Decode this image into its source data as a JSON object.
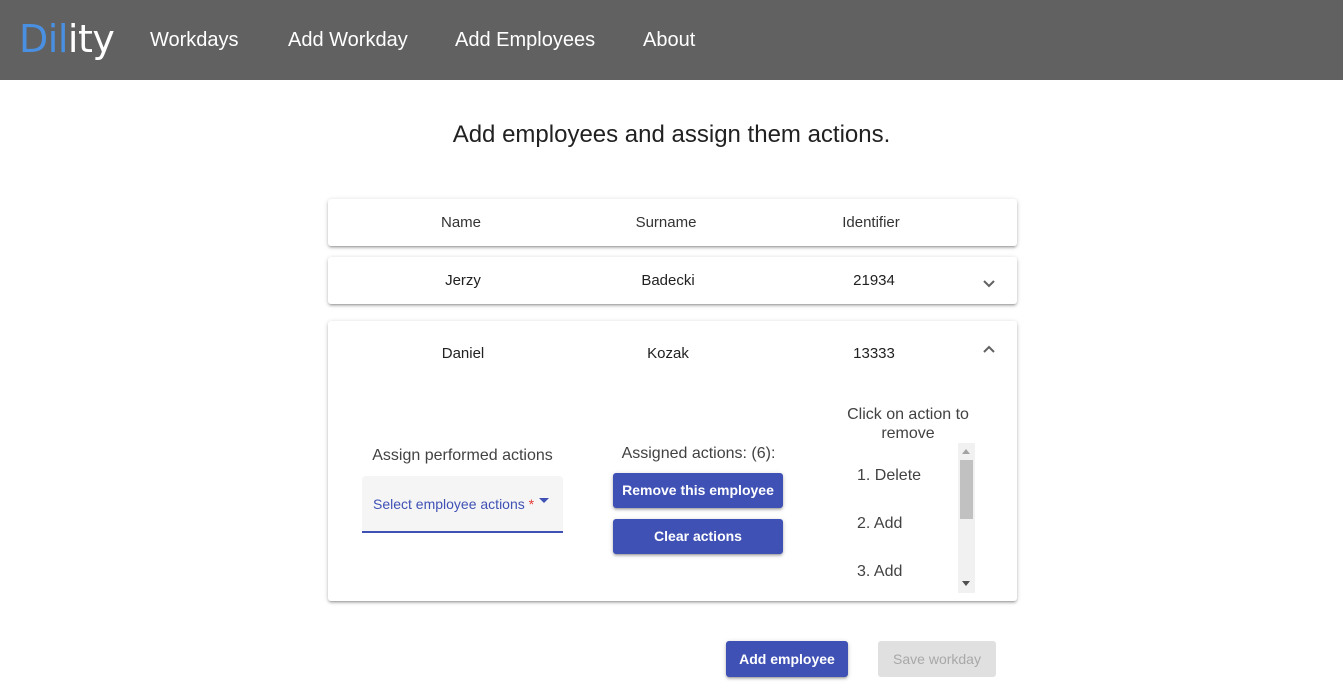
{
  "app": {
    "logo_part1": "Dil",
    "logo_part2": "ity",
    "nav": [
      "Workdays",
      "Add Workday",
      "Add Employees",
      "About"
    ]
  },
  "page": {
    "heading": "Add employees and assign them actions."
  },
  "table": {
    "headers": [
      "Name",
      "Surname",
      "Identifier"
    ],
    "rows": [
      {
        "name": "Jerzy",
        "surname": "Badecki",
        "identifier": "21934",
        "expanded": false
      },
      {
        "name": "Daniel",
        "surname": "Kozak",
        "identifier": "13333",
        "expanded": true
      }
    ]
  },
  "expanded": {
    "assign_label": "Assign performed actions",
    "select_placeholder": "Select employee actions",
    "required_mark": "*",
    "assigned_label": "Assigned actions: (6):",
    "remove_button": "Remove this employee",
    "clear_button": "Clear actions",
    "remove_hint": "Click on action to remove",
    "actions": [
      "1. Delete",
      "2. Add",
      "3. Add"
    ]
  },
  "footer": {
    "add_employee": "Add employee",
    "save_workday": "Save workday"
  },
  "icons": {
    "collapsed": "chevron-down-icon",
    "expanded": "chevron-up-icon",
    "select": "caret-down-icon"
  },
  "colors": {
    "topbar": "#616161",
    "logo_accent": "#4a90e2",
    "primary": "#3f51b5",
    "disabled": "#e0e0e0",
    "required": "#e53935"
  }
}
